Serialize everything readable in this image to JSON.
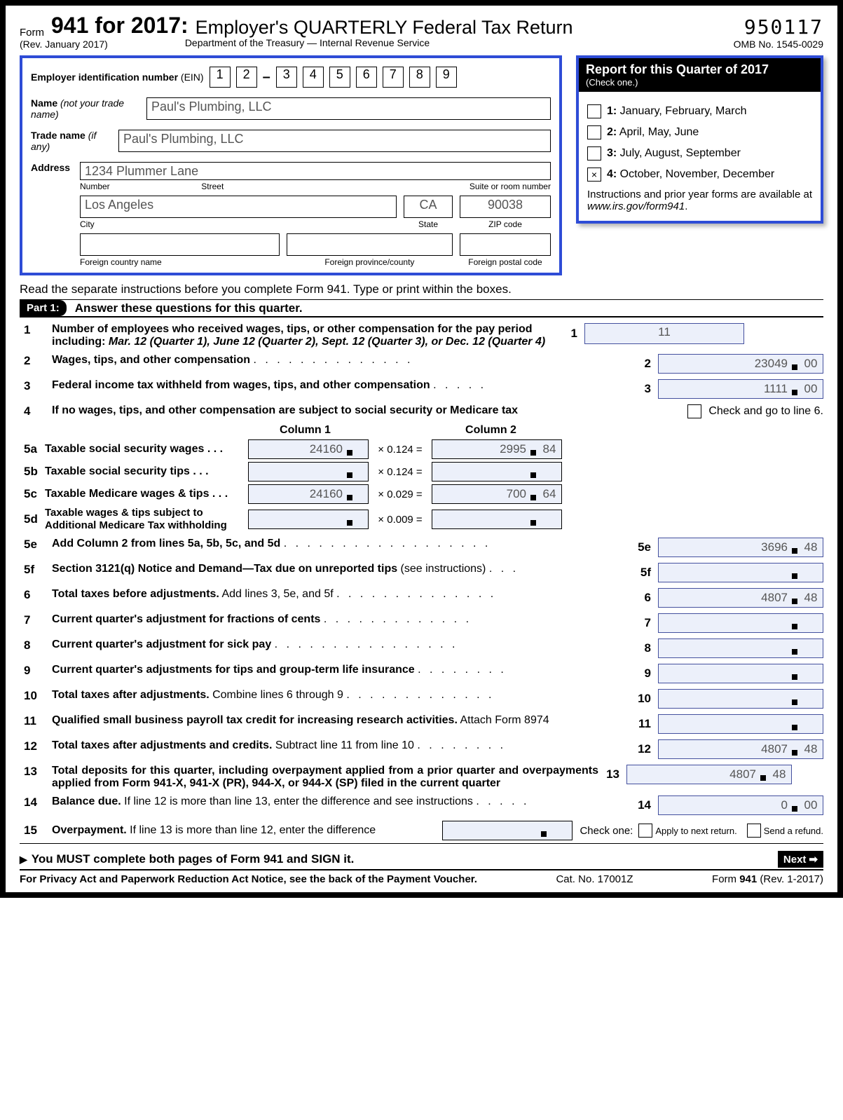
{
  "header": {
    "form_word": "Form",
    "title": "941 for 2017:",
    "subtitle": "Employer's QUARTERLY Federal Tax Return",
    "rev": "(Rev. January 2017)",
    "dept": "Department of the Treasury — Internal Revenue Service",
    "ocr": "950117",
    "omb": "OMB No. 1545-0029"
  },
  "employer": {
    "ein_label": "Employer identification number",
    "ein_abbr": "(EIN)",
    "ein": [
      "1",
      "2",
      "3",
      "4",
      "5",
      "6",
      "7",
      "8",
      "9"
    ],
    "name_label": "Name",
    "name_hint": "(not your trade name)",
    "name": "Paul's Plumbing, LLC",
    "trade_label": "Trade name",
    "trade_hint": "(if any)",
    "trade": "Paul's Plumbing, LLC",
    "address_label": "Address",
    "street": "1234 Plummer Lane",
    "street_sub": {
      "number": "Number",
      "street": "Street",
      "suite": "Suite or room number"
    },
    "city": "Los Angeles",
    "state": "CA",
    "zip": "90038",
    "city_sub": {
      "city": "City",
      "state": "State",
      "zip": "ZIP code"
    },
    "foreign_sub": {
      "country": "Foreign country name",
      "prov": "Foreign province/county",
      "postal": "Foreign postal code"
    }
  },
  "quarter": {
    "title": "Report for this Quarter of 2017",
    "sub": "(Check one.)",
    "opts": [
      {
        "num": "1:",
        "txt": "January, February, March",
        "checked": false
      },
      {
        "num": "2:",
        "txt": "April, May, June",
        "checked": false
      },
      {
        "num": "3:",
        "txt": "July, August, September",
        "checked": false
      },
      {
        "num": "4:",
        "txt": "October, November, December",
        "checked": true
      }
    ],
    "note1": "Instructions and prior year forms are available at ",
    "note2": "www.irs.gov/form941"
  },
  "instr": "Read the separate instructions before you complete Form 941. Type or print within the boxes.",
  "part1": {
    "pill": "Part 1:",
    "text": "Answer these questions for this quarter."
  },
  "lines": {
    "l1": {
      "num": "1",
      "text1": "Number of employees who received wages, tips, or other compensation for the pay period including: ",
      "dates": "Mar. 12 (Quarter 1), June 12 (Quarter 2), Sept. 12 (Quarter 3), or Dec. 12 (Quarter 4)",
      "rnum": "1",
      "val": "11"
    },
    "l2": {
      "num": "2",
      "text": "Wages, tips, and other compensation",
      "rnum": "2",
      "d": "23049",
      "c": "00"
    },
    "l3": {
      "num": "3",
      "text": "Federal income tax withheld from wages, tips, and other compensation",
      "rnum": "3",
      "d": "1111",
      "c": "00"
    },
    "l4": {
      "num": "4",
      "text": "If no wages, tips, and other compensation are subject to social security or Medicare tax",
      "chk": "Check and go to line 6."
    },
    "cols": {
      "c1": "Column 1",
      "c2": "Column 2"
    },
    "l5a": {
      "num": "5a",
      "text": "Taxable social security wages",
      "c1d": "24160",
      "mult": "× 0.124 =",
      "c2d": "2995",
      "c2c": "84"
    },
    "l5b": {
      "num": "5b",
      "text": "Taxable social security tips",
      "mult": "× 0.124 ="
    },
    "l5c": {
      "num": "5c",
      "text": "Taxable Medicare wages & tips",
      "c1d": "24160",
      "mult": "× 0.029 =",
      "c2d": "700",
      "c2c": "64"
    },
    "l5d": {
      "num": "5d",
      "text": "Taxable wages & tips subject to Additional Medicare Tax withholding",
      "mult": "× 0.009 ="
    },
    "l5e": {
      "num": "5e",
      "text": "Add Column 2 from lines 5a, 5b, 5c, and 5d",
      "rnum": "5e",
      "d": "3696",
      "c": "48"
    },
    "l5f": {
      "num": "5f",
      "text": "Section 3121(q) Notice and Demand—Tax due on unreported tips",
      "thin": " (see instructions)",
      "rnum": "5f"
    },
    "l6": {
      "num": "6",
      "text": "Total taxes before adjustments.",
      "thin": " Add lines 3, 5e, and 5f",
      "rnum": "6",
      "d": "4807",
      "c": "48"
    },
    "l7": {
      "num": "7",
      "text": "Current quarter's adjustment for fractions of cents",
      "rnum": "7"
    },
    "l8": {
      "num": "8",
      "text": "Current quarter's adjustment for sick pay",
      "rnum": "8"
    },
    "l9": {
      "num": "9",
      "text": "Current quarter's adjustments for tips and group-term life insurance",
      "rnum": "9"
    },
    "l10": {
      "num": "10",
      "text": "Total taxes after adjustments.",
      "thin": " Combine lines 6 through 9",
      "rnum": "10"
    },
    "l11": {
      "num": "11",
      "text": "Qualified small business payroll tax credit for increasing research activities.",
      "thin": " Attach Form 8974",
      "rnum": "11"
    },
    "l12": {
      "num": "12",
      "text": "Total taxes after adjustments and credits.",
      "thin": " Subtract line 11 from line 10",
      "rnum": "12",
      "d": "4807",
      "c": "48"
    },
    "l13": {
      "num": "13",
      "text": "Total deposits for this quarter, including overpayment applied from a prior quarter and overpayments applied from Form 941-X, 941-X (PR), 944-X, or 944-X (SP) filed in the current quarter",
      "rnum": "13",
      "d": "4807",
      "c": "48"
    },
    "l14": {
      "num": "14",
      "text": "Balance due.",
      "thin": " If line 12 is more than line 13, enter the difference and see instructions",
      "rnum": "14",
      "d": "0",
      "c": "00"
    },
    "l15": {
      "num": "15",
      "text": "Overpayment.",
      "thin": " If line 13 is more than line 12, enter the difference",
      "chk_one": "Check one:",
      "op1": "Apply to next return.",
      "op2": "Send a refund."
    }
  },
  "must": "You MUST complete both pages of Form 941 and SIGN it.",
  "next": "Next",
  "footer": {
    "privacy": "For Privacy Act and Paperwork Reduction Act Notice, see the back of the Payment Voucher.",
    "cat": "Cat. No. 17001Z",
    "form": "Form",
    "num": "941",
    "rev": "(Rev. 1-2017)"
  }
}
